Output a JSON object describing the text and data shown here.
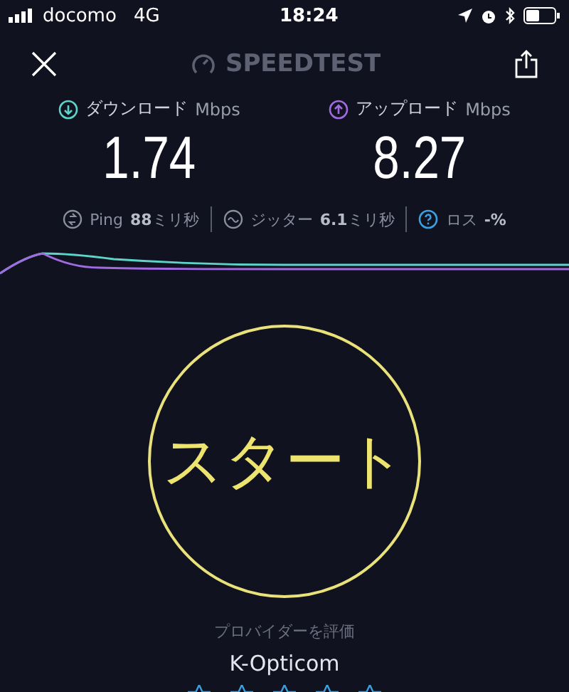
{
  "status_bar": {
    "carrier": "docomo",
    "network": "4G",
    "time": "18:24"
  },
  "header": {
    "title": "SPEEDTEST"
  },
  "results": [
    {
      "kind": "download",
      "label": "ダウンロード",
      "unit": "Mbps",
      "value": "1.74"
    },
    {
      "kind": "upload",
      "label": "アップロード",
      "unit": "Mbps",
      "value": "8.27"
    }
  ],
  "metrics": [
    {
      "kind": "ping",
      "label": "Ping",
      "value": "88",
      "unit": "ミリ秒"
    },
    {
      "kind": "jitter",
      "label": "ジッター",
      "value": "6.1",
      "unit": "ミリ秒"
    },
    {
      "kind": "loss",
      "label": "ロス",
      "value": "-%"
    }
  ],
  "start_button": {
    "label": "スタート"
  },
  "provider": {
    "prompt": "プロバイダーを評価",
    "name": "K-Opticom"
  }
}
